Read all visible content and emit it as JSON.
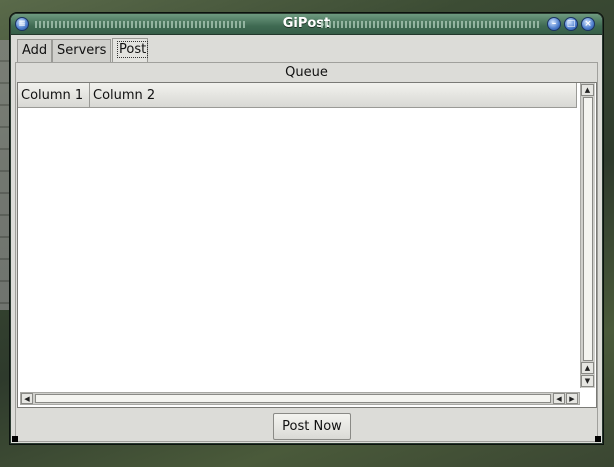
{
  "window": {
    "title": "GiPost"
  },
  "titlebar_buttons": {
    "menu_icon": "menu-icon",
    "minimize_icon": "minimize-icon",
    "maximize_icon": "maximize-icon",
    "close_icon": "close-icon"
  },
  "tabs": [
    {
      "label": "Add",
      "active": false
    },
    {
      "label": "Servers",
      "active": false
    },
    {
      "label": "Post",
      "active": true
    }
  ],
  "post": {
    "queue_label": "Queue",
    "columns": [
      "Column 1",
      "Column 2"
    ],
    "rows": [],
    "post_now_label": "Post Now"
  },
  "colors": {
    "titlebar": "#3f6a52",
    "window_bg": "#dcdcd8",
    "list_bg": "#ffffff"
  }
}
